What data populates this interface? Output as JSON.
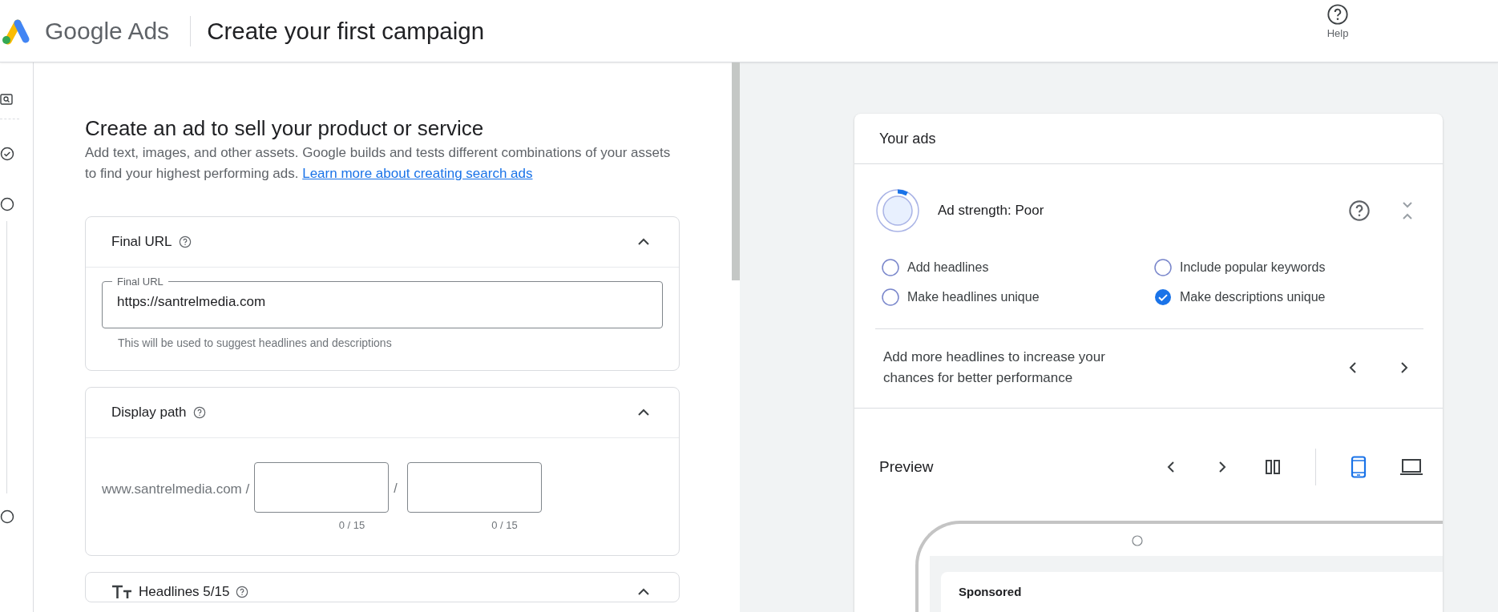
{
  "header": {
    "product": "Google Ads",
    "title": "Create your first campaign",
    "help_label": "Help"
  },
  "rail": {
    "steps": [
      {
        "done": true
      },
      {
        "done": false
      },
      {
        "done": false
      }
    ]
  },
  "editor": {
    "heading": "Create an ad to sell your product or service",
    "description": "Add text, images, and other assets. Google builds and tests different combinations of your assets to find your highest performing ads.",
    "link": "Learn more about creating search ads",
    "sections": [
      {
        "kind": "final_url",
        "title": "Final URL",
        "expanded": true,
        "field_label": "Final URL",
        "value": "https://santrelmedia.com",
        "hint": "This will be used to suggest headlines and descriptions"
      },
      {
        "kind": "display_path",
        "title": "Display path",
        "expanded": true,
        "domain": "www.santrelmedia.com /",
        "separator": "/",
        "paths": [
          {
            "counter": "0 / 15"
          },
          {
            "counter": "0 / 15"
          }
        ]
      },
      {
        "kind": "headlines",
        "title": "Headlines 5/15",
        "expanded": true
      }
    ]
  },
  "ads": {
    "title": "Your ads",
    "strength": {
      "label": "Ad strength: Poor",
      "level": 0.08
    },
    "checklist": [
      {
        "label": "Add headlines",
        "checked": false
      },
      {
        "label": "Include popular keywords",
        "checked": false
      },
      {
        "label": "Make headlines unique",
        "checked": false
      },
      {
        "label": "Make descriptions unique",
        "checked": true
      }
    ],
    "tip": "Add more headlines to increase your chances for better performance",
    "preview": {
      "title": "Preview",
      "devices": [
        {
          "kind": "mobile",
          "selected": true
        },
        {
          "kind": "desktop",
          "selected": false
        }
      ],
      "sponsored": "Sponsored"
    }
  }
}
